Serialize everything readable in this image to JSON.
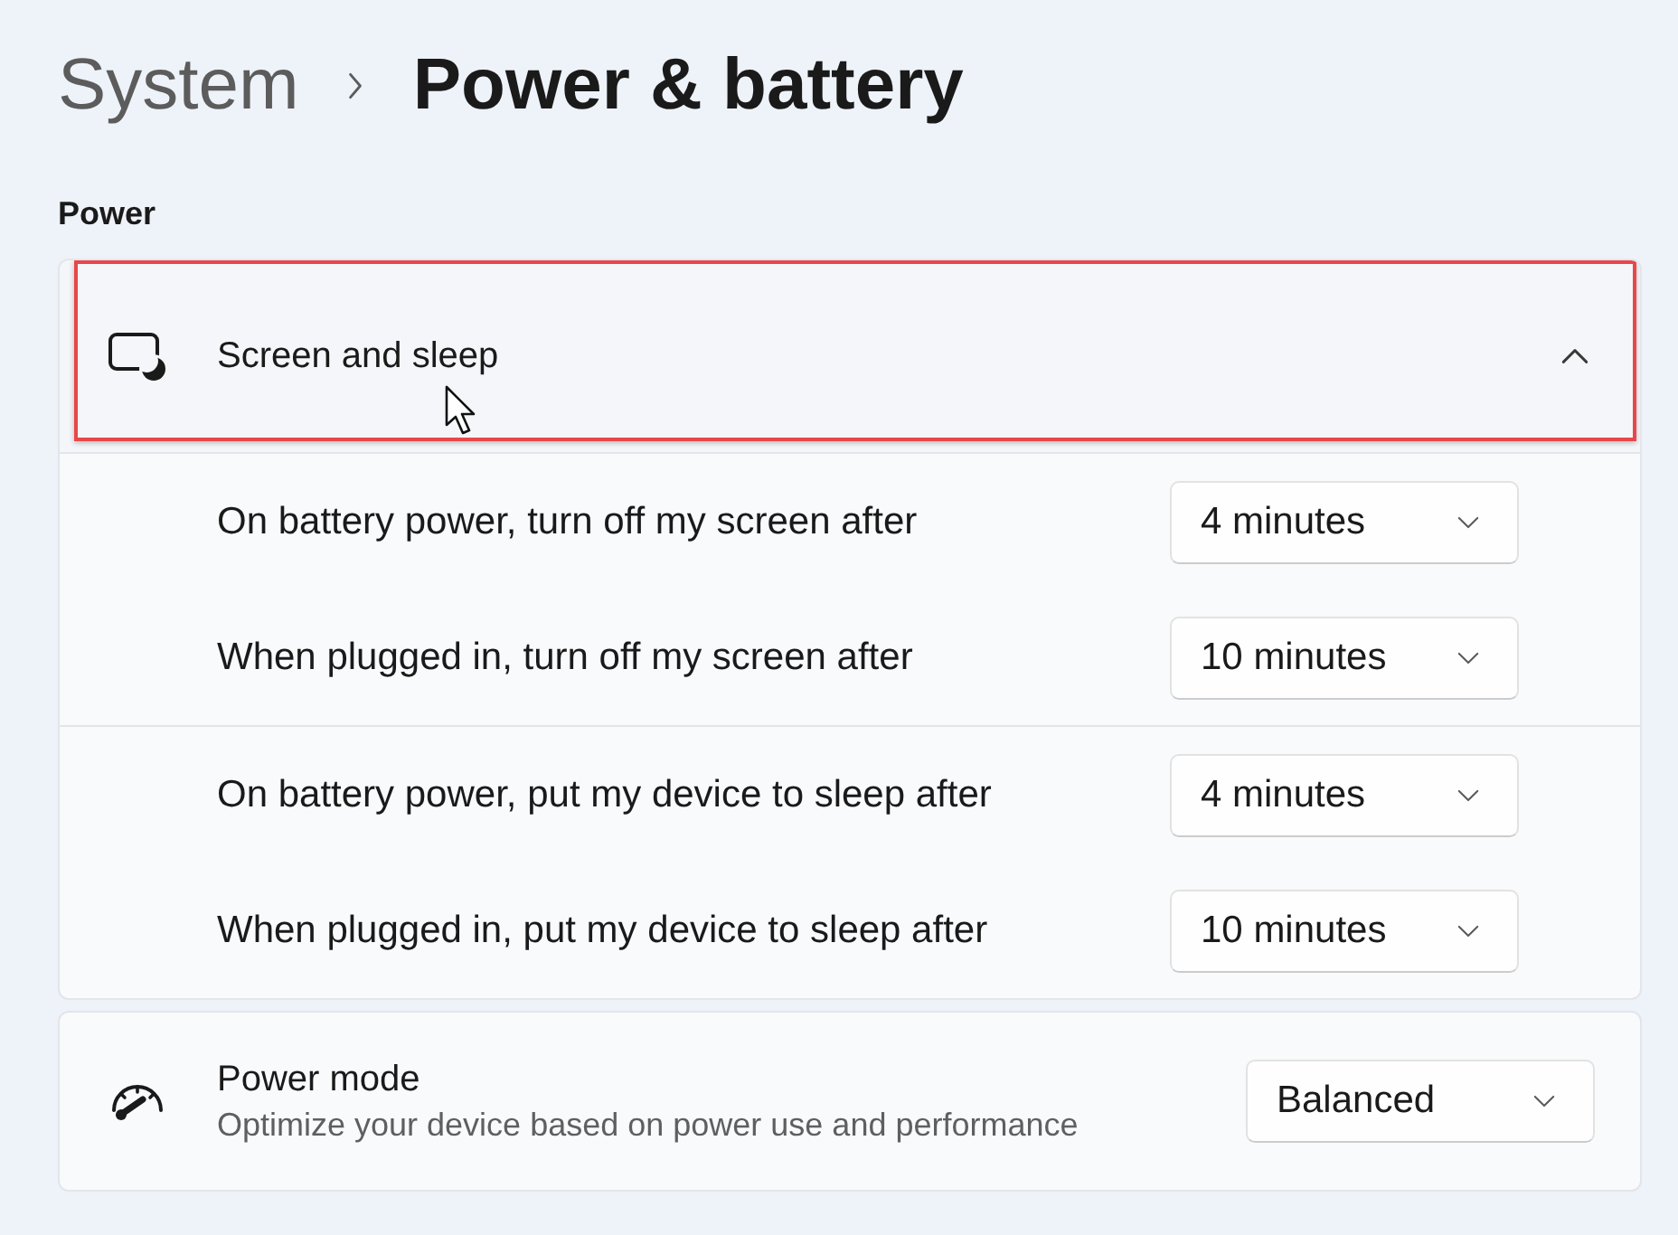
{
  "breadcrumb": {
    "parent": "System",
    "current": "Power & battery"
  },
  "section": {
    "title": "Power"
  },
  "screen_and_sleep": {
    "title": "Screen and sleep",
    "expanded": true,
    "highlighted": true,
    "hovered": true,
    "groups": [
      {
        "settings": [
          {
            "label": "On battery power, turn off my screen after",
            "value": "4 minutes"
          },
          {
            "label": "When plugged in, turn off my screen after",
            "value": "10 minutes"
          }
        ]
      },
      {
        "settings": [
          {
            "label": "On battery power, put my device to sleep after",
            "value": "4 minutes"
          },
          {
            "label": "When plugged in, put my device to sleep after",
            "value": "10 minutes"
          }
        ]
      }
    ]
  },
  "power_mode": {
    "title": "Power mode",
    "description": "Optimize your device based on power use and performance",
    "value": "Balanced"
  }
}
